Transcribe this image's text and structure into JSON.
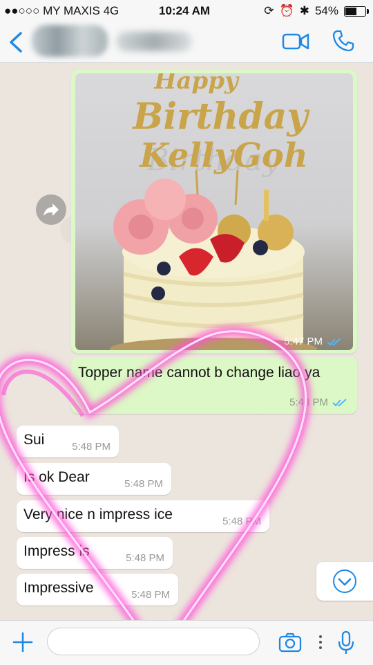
{
  "status_bar": {
    "carrier": "●●○○○ MY MAXIS  4G",
    "time": "10:24 AM",
    "battery": "54%",
    "battery_level": 0.54
  },
  "header": {
    "contact_name": "",
    "icons": [
      "back-icon",
      "video-call-icon",
      "phone-call-icon"
    ]
  },
  "chat": {
    "image_message": {
      "topper_text": "Happy Birthday Kelly Goh",
      "time": "5:47 PM",
      "read": true
    },
    "outgoing_text": {
      "text": "Topper name cannot b change liao ya",
      "time": "5:48 PM",
      "read": true
    },
    "incoming": [
      {
        "text": "Sui",
        "time": "5:48 PM"
      },
      {
        "text": "Is ok Dear",
        "time": "5:48 PM"
      },
      {
        "text": "Very nice n impress ice",
        "time": "5:48 PM"
      },
      {
        "text": "Impress is",
        "time": "5:48 PM"
      },
      {
        "text": "Impressive",
        "time": "5:48 PM"
      }
    ]
  },
  "input": {
    "placeholder": ""
  },
  "colors": {
    "accent": "#1e88e5",
    "outgoing_bubble": "#dcf8c6",
    "incoming_bubble": "#ffffff",
    "heart": "#ff4fd8"
  }
}
